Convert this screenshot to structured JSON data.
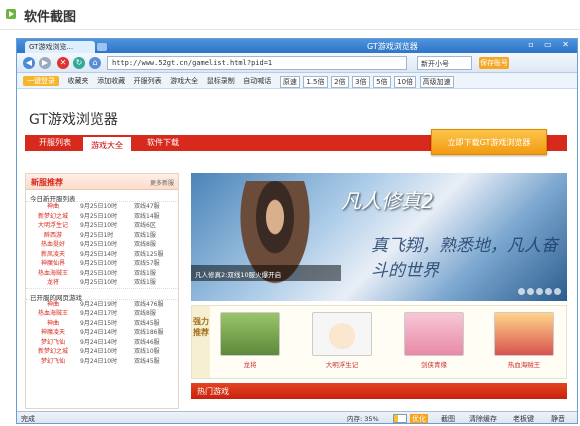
{
  "page_header": {
    "title": "软件截图"
  },
  "browser": {
    "tab_title": "GT游戏浏览...",
    "window_title": "GT游戏浏览器",
    "url": "http://www.52gt.cn/gamelist.html?pid=1",
    "search_text": "新开小号",
    "save_label": "保存账号",
    "favbar": {
      "first": "一键登录",
      "items": [
        "收藏夹",
        "添加收藏",
        "开服列表",
        "游戏大全",
        "鼠标录制",
        "自动喊话",
        "原速",
        "1.5倍",
        "2倍",
        "3倍",
        "5倍",
        "10倍",
        "高级加速"
      ]
    },
    "status_left": "完成",
    "memory_label": "内存: 35%",
    "memory_value": 0.35,
    "memory_btn": "优化",
    "status_tools": [
      "截图",
      "清除缓存",
      "老板键",
      "静音"
    ]
  },
  "site": {
    "logo": "GT游戏浏览器",
    "nav": [
      "开服列表",
      "游戏大全",
      "软件下载"
    ],
    "download_btn": "立即下载GT游戏浏览器",
    "newserver": {
      "title": "新服推荐",
      "more": "更多新服",
      "today_label": "今日新开服列表",
      "today": [
        {
          "name": "神曲",
          "date": "9月25日10时",
          "server": "双线47服"
        },
        {
          "name": "新梦幻之城",
          "date": "9月25日10时",
          "server": "双线14服"
        },
        {
          "name": "大明浮生记",
          "date": "9月25日10时",
          "server": "双线6区"
        },
        {
          "name": "醉西游",
          "date": "9月25日1时",
          "server": "双线1服"
        },
        {
          "name": "热血挺好",
          "date": "9月25日10时",
          "server": "双线8服"
        },
        {
          "name": "新凤凌天",
          "date": "9月25日14时",
          "server": "双线125服"
        },
        {
          "name": "神魔仙界",
          "date": "9月25日10时",
          "server": "双线57服"
        },
        {
          "name": "热血海贼王",
          "date": "9月25日10时",
          "server": "双线1服"
        },
        {
          "name": "龙将",
          "date": "9月25日10时",
          "server": "双线1服"
        }
      ],
      "past_label": "已开服的网页游戏",
      "past": [
        {
          "name": "神曲",
          "date": "9月24日19时",
          "server": "双线476服"
        },
        {
          "name": "热血海贼王",
          "date": "9月24日17时",
          "server": "双线8服"
        },
        {
          "name": "神曲",
          "date": "9月24日15时",
          "server": "双线45服"
        },
        {
          "name": "神魔凌天",
          "date": "9月24日14时",
          "server": "双线186服"
        },
        {
          "name": "梦幻飞仙",
          "date": "9月24日14时",
          "server": "双线46服"
        },
        {
          "name": "新梦幻之城",
          "date": "9月24日10时",
          "server": "双线10服"
        },
        {
          "name": "梦幻飞仙",
          "date": "9月24日10时",
          "server": "双线45服"
        }
      ]
    },
    "banner": {
      "logo": "凡人修真2",
      "slogan": "真飞翔，熟悉地，凡人奋斗的世界",
      "caption": "凡人修真2:双线10服火爆开启"
    },
    "recommend": {
      "label": "强力推荐",
      "items": [
        "龙将",
        "大明浮生记",
        "剑侠青缘",
        "热血海贼王"
      ]
    },
    "hot_title": "热门游戏"
  }
}
